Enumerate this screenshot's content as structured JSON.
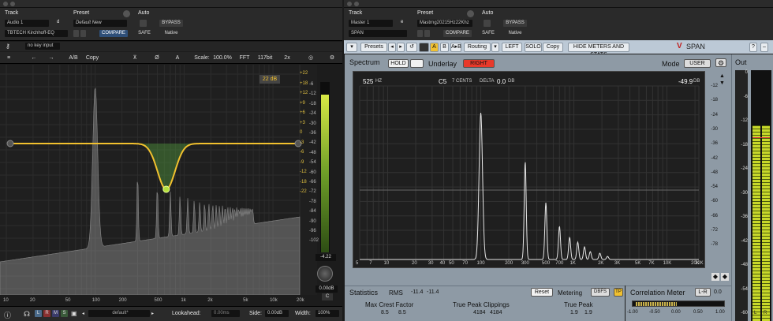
{
  "left": {
    "header": {
      "track_label": "Track",
      "track_name": "Audio 1",
      "track_letter": "d",
      "plugin_name": "TBTECH Kirchhoff-EQ",
      "preset_label": "Preset",
      "preset_name": "Default New",
      "compare": "COMPARE",
      "auto_label": "Auto",
      "bypass": "BYPASS",
      "safe": "SAFE",
      "native": "Native",
      "key_input": "no key input"
    },
    "toolbar": {
      "ab": "A/B",
      "copy": "Copy",
      "a": "A",
      "scale_label": "Scale:",
      "scale_value": "100.0%",
      "fft": "FFT",
      "bits": "117bit",
      "zoom": "2x"
    },
    "display": {
      "range_badge": "22 dB",
      "meter_value": "-4.22",
      "out_gain": "0.00dB",
      "out_channel": "C"
    },
    "y_ticks_gold": [
      "+22",
      "+18",
      "+12",
      "+9",
      "+6",
      "+3",
      "0",
      "-3",
      "-6",
      "-9",
      "-12",
      "-18",
      "-22"
    ],
    "y_ticks_gray": [
      "-6",
      "-12",
      "-18",
      "-24",
      "-30",
      "-36",
      "-42",
      "-48",
      "-54",
      "-60",
      "-66",
      "-72",
      "-78",
      "-84",
      "-90",
      "-96",
      "-102"
    ],
    "x_ticks": [
      "10",
      "20",
      "50",
      "100",
      "200",
      "500",
      "1k",
      "2k",
      "5k",
      "10k",
      "20k"
    ],
    "bottom": {
      "l": "L",
      "r": "R",
      "m": "M",
      "s": "S",
      "preset": "default*",
      "lookahead_label": "Lookahead:",
      "lookahead_value": "0.00ms",
      "side_label": "Side:",
      "side_value": "0.00dB",
      "width_label": "Width:",
      "width_value": "100%"
    },
    "colors": {
      "curve": "#f2c12e",
      "meter": "#b6e03c"
    }
  },
  "right": {
    "header": {
      "track_label": "Track",
      "track_name": "Master 1",
      "track_letter": "e",
      "plugin_name": "SPAN",
      "preset_label": "Preset",
      "preset_name": "Mastrng20215Hz22Khz",
      "compare": "COMPARE",
      "auto_label": "Auto",
      "bypass": "BYPASS",
      "safe": "SAFE",
      "native": "Native"
    },
    "toolbar": {
      "presets": "Presets",
      "a": "A",
      "b": "B",
      "atob": "A▸B",
      "routing": "Routing",
      "left": "LEFT",
      "solo": "SOLO",
      "copy": "Copy",
      "hide": "HIDE METERS AND STATS",
      "brand": "SPAN"
    },
    "spectrum": {
      "title": "Spectrum",
      "hold": "HOLD",
      "underlay": "Underlay",
      "right": "RIGHT",
      "mode_label": "Mode",
      "mode_value": "USER",
      "out_label": "Out",
      "readout_freq": "525",
      "readout_freq_unit": "HZ",
      "readout_note": "C5",
      "readout_cents": "7 CENTS",
      "readout_delta_label": "DELTA",
      "readout_delta": "0.0",
      "readout_delta_unit": "DB",
      "readout_level": "-49.9",
      "readout_level_unit": "DB"
    },
    "y_ticks": [
      "-12",
      "-18",
      "-24",
      "-30",
      "-36",
      "-42",
      "-48",
      "-54",
      "-60",
      "-66",
      "-72",
      "-78"
    ],
    "x_ticks": [
      "5",
      "7",
      "10",
      "20",
      "30",
      "40",
      "50",
      "70",
      "100",
      "200",
      "300",
      "500",
      "700",
      "1K",
      "2K",
      "3K",
      "5K",
      "7K",
      "10K",
      "20K",
      "22K"
    ],
    "statistics": {
      "title": "Statistics",
      "rms_label": "RMS",
      "rms_l": "-11.4",
      "rms_r": "-11.4",
      "reset": "Reset",
      "metering_label": "Metering",
      "dbfs": "DBFS",
      "tp": "TP",
      "crest_label": "Max Crest Factor",
      "crest_l": "8.5",
      "crest_r": "8.5",
      "clip_label": "True Peak Clippings",
      "clip_l": "4184",
      "clip_r": "4184",
      "tpeak_label": "True Peak",
      "tpeak_l": "1.9",
      "tpeak_r": "1.9"
    },
    "correlation": {
      "title": "Correlation Meter",
      "lr": "L-R",
      "value": "0.0",
      "scale": [
        "-1.00",
        "-0.50",
        "0.00",
        "0.50",
        "1.00"
      ]
    },
    "out_ticks": [
      "0",
      "-6",
      "-12",
      "-18",
      "-24",
      "-30",
      "-36",
      "-42",
      "-48",
      "-54",
      "-60"
    ],
    "out_lr": {
      "l": "L",
      "r": "R"
    },
    "colors": {
      "accent": "#e8392a",
      "window": "#8e9aa5",
      "display": "#1f1f1f"
    }
  }
}
